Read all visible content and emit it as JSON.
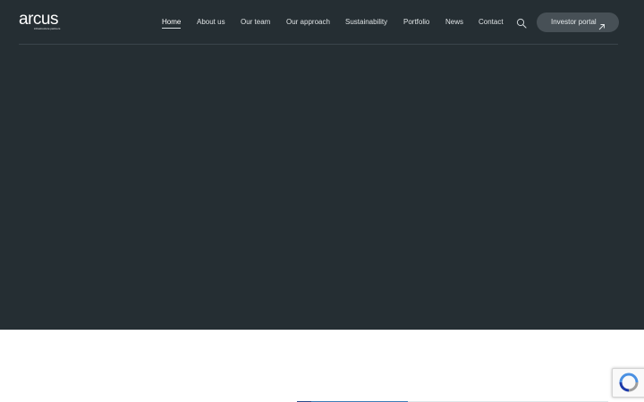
{
  "brand": {
    "name": "arcus",
    "tagline": "infrastructure partners"
  },
  "nav": {
    "items": [
      {
        "label": "Home",
        "active": true
      },
      {
        "label": "About us",
        "active": false
      },
      {
        "label": "Our team",
        "active": false
      },
      {
        "label": "Our approach",
        "active": false
      },
      {
        "label": "Sustainability",
        "active": false
      },
      {
        "label": "Portfolio",
        "active": false
      },
      {
        "label": "News",
        "active": false
      },
      {
        "label": "Contact",
        "active": false
      }
    ],
    "search_icon": "search-icon",
    "portal_label": "Investor portal",
    "portal_icon": "external-arrow-icon"
  },
  "colors": {
    "hero_bg": "#252e33",
    "portal_bg": "#475056",
    "page_bg": "#ffffff"
  },
  "recaptcha": {
    "icon": "recaptcha-icon"
  }
}
